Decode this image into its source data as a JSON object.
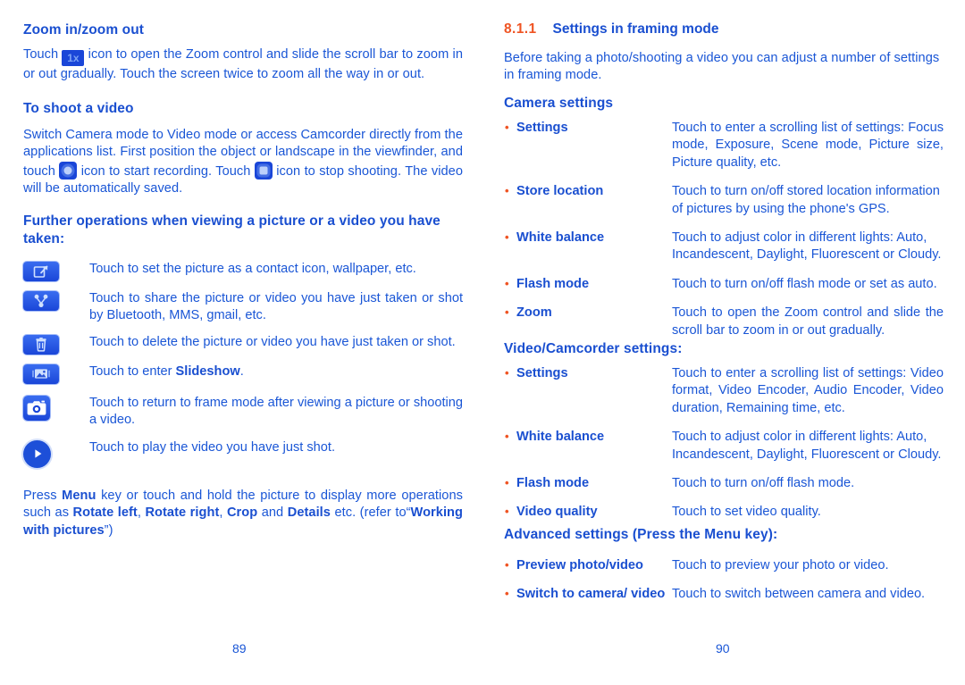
{
  "colors": {
    "body_blue": "#1a56d6",
    "heading_blue": "#1a4fd0",
    "accent_orange": "#ef5423",
    "icon_blue": "#1a46d8"
  },
  "left_page": {
    "page_number": "89",
    "heading_zoom": "Zoom in/zoom out",
    "zoom_badge_label": "1x",
    "para_zoom_before": "Touch ",
    "para_zoom_after": " icon to open the Zoom control and slide the scroll bar to zoom in or out gradually. Touch the screen twice to zoom all the way in or out.",
    "heading_shoot_video": "To shoot a video",
    "para_video_p1": "Switch Camera mode to Video mode or access Camcorder directly from the applications list. First position the object or landscape in the viewfinder, and touch ",
    "para_video_p2": " icon to start recording. Touch ",
    "para_video_p3": " icon to stop shooting. The video will be automatically saved.",
    "heading_further": "Further operations when viewing a picture or a video you have taken:",
    "icon_rows": [
      {
        "icon": "set-as-icon",
        "text": "Touch to set the picture as a contact icon, wallpaper, etc."
      },
      {
        "icon": "share-icon",
        "text": "Touch to share the picture or video you have just taken or shot by Bluetooth, MMS, gmail, etc."
      },
      {
        "icon": "trash-icon",
        "text": "Touch to delete the picture or video you have just taken or shot."
      },
      {
        "icon": "slideshow-icon",
        "text_before": "Touch to enter ",
        "bold": "Slideshow",
        "text_after": "."
      },
      {
        "icon": "camera-icon",
        "text": "Touch to return to frame mode after viewing a picture or shooting a video."
      },
      {
        "icon": "play-icon",
        "text": "Touch to play the video you have just shot."
      }
    ],
    "footer_para": {
      "t1": "Press ",
      "b1": "Menu",
      "t2": " key or touch and hold the picture to display more operations such as ",
      "b2": "Rotate left",
      "t3": ", ",
      "b3": "Rotate right",
      "t4": ", ",
      "b4": "Crop",
      "t5": " and ",
      "b5": "Details",
      "t6": " etc. (refer to“",
      "b6": "Working with pictures",
      "t7": "”)"
    }
  },
  "right_page": {
    "page_number": "90",
    "section_number": "8.1.1",
    "section_title": "Settings in framing mode",
    "intro_para": "Before taking a photo/shooting a video you can adjust a number of settings in framing mode.",
    "camera_settings_heading": "Camera settings",
    "camera_settings": [
      {
        "term": "Settings",
        "desc": "Touch to enter a scrolling list of settings: Focus mode, Exposure, Scene mode, Picture size, Picture quality, etc."
      },
      {
        "term": "Store location",
        "desc": "Touch to turn on/off stored location information of pictures by using the phone's GPS."
      },
      {
        "term": "White balance",
        "desc": "Touch to adjust color in different lights: Auto, Incandescent, Daylight, Fluorescent or Cloudy."
      },
      {
        "term": "Flash mode",
        "desc": "Touch to turn on/off flash mode or set as auto."
      },
      {
        "term": "Zoom",
        "desc": "Touch to open the Zoom control and slide the scroll bar to zoom in or out gradually."
      }
    ],
    "video_settings_heading": "Video/Camcorder settings:",
    "video_settings": [
      {
        "term": "Settings",
        "desc": "Touch to enter a scrolling list of settings: Video format, Video Encoder, Audio Encoder, Video duration, Remaining time, etc."
      },
      {
        "term": "White balance",
        "desc": "Touch to adjust color in different lights: Auto, Incandescent, Daylight, Fluorescent or Cloudy."
      },
      {
        "term": "Flash mode",
        "desc": "Touch to turn on/off flash mode."
      },
      {
        "term": "Video quality",
        "desc": "Touch to set video quality."
      }
    ],
    "advanced_settings_heading": "Advanced settings (Press the Menu key):",
    "advanced_settings": [
      {
        "term": "Preview photo/video",
        "desc": "Touch to preview your photo or video."
      },
      {
        "term": "Switch to camera/ video",
        "desc": "Touch to switch between camera and video."
      }
    ]
  }
}
